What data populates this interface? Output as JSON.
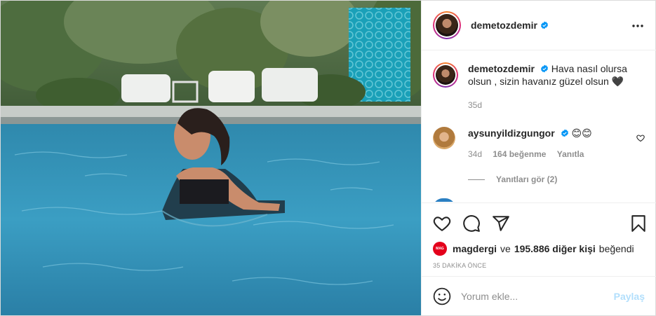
{
  "post": {
    "author": "demetozdemir",
    "caption_text": "Hava nasıl olursa olsun , sizin havanız güzel olsun 🖤",
    "caption_age": "35d",
    "timestamp": "35 DAKİKA ÖNCE"
  },
  "comments": [
    {
      "username": "aysunyildizgungor",
      "text": "😊😊",
      "age": "34d",
      "likes": "164 beğenme",
      "reply_label": "Yanıtla",
      "view_replies": "Yanıtları gör (2)"
    }
  ],
  "likes": {
    "liker": "magdergi",
    "connector": "ve",
    "others": "195.886 diğer kişi",
    "suffix": "beğendi",
    "liker_avatar_text": "MAG"
  },
  "add_comment": {
    "placeholder": "Yorum ekle...",
    "post_label": "Paylaş"
  },
  "colors": {
    "verified": "#0095f6",
    "post_button_disabled": "#b2dffc",
    "muted_text": "#8e8e8e"
  },
  "icons": [
    "verified-badge-icon",
    "more-options-icon",
    "heart-icon",
    "comment-icon",
    "share-icon",
    "save-icon",
    "emoji-icon"
  ]
}
